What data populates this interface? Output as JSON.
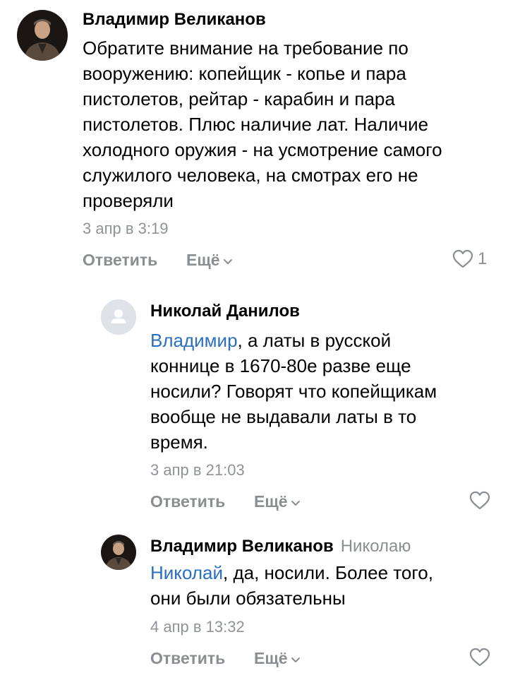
{
  "comments": [
    {
      "author": "Владимир Великанов",
      "reply_to": "",
      "mention": "",
      "text": "Обратите внимание на требование по\nвооружению: копейщик - копье и пара\nпистолетов, рейтар - карабин и пара\nпистолетов. Плюс наличие лат. Наличие\nхолодного оружия - на усмотрение самого\nслужилого человека, на смотрах его не\nпроверяли",
      "date": "3 апр в 3:19",
      "reply_label": "Ответить",
      "more_label": "Ещё",
      "likes": "1",
      "avatar_icon": "user-photo-icon"
    },
    {
      "author": "Николай Данилов",
      "reply_to": "",
      "mention": "Владимир",
      "text": ", а латы в русской\nконнице в 1670-80е разве еще\nносили? Говорят что копейщикам\nвообще не выдавали латы в то\nвремя.",
      "date": "3 апр в 21:03",
      "reply_label": "Ответить",
      "more_label": "Ещё",
      "likes": "",
      "avatar_icon": "default-avatar-icon"
    },
    {
      "author": "Владимир Великанов",
      "reply_to": "Николаю",
      "mention": "Николай",
      "text": ", да, носили. Более того,\nони были обязательны",
      "date": "4 апр в 13:32",
      "reply_label": "Ответить",
      "more_label": "Ещё",
      "likes": "",
      "avatar_icon": "user-photo-icon"
    }
  ],
  "colors": {
    "link": "#2a6fc1",
    "secondary": "#8a8e93",
    "text": "#000000"
  }
}
